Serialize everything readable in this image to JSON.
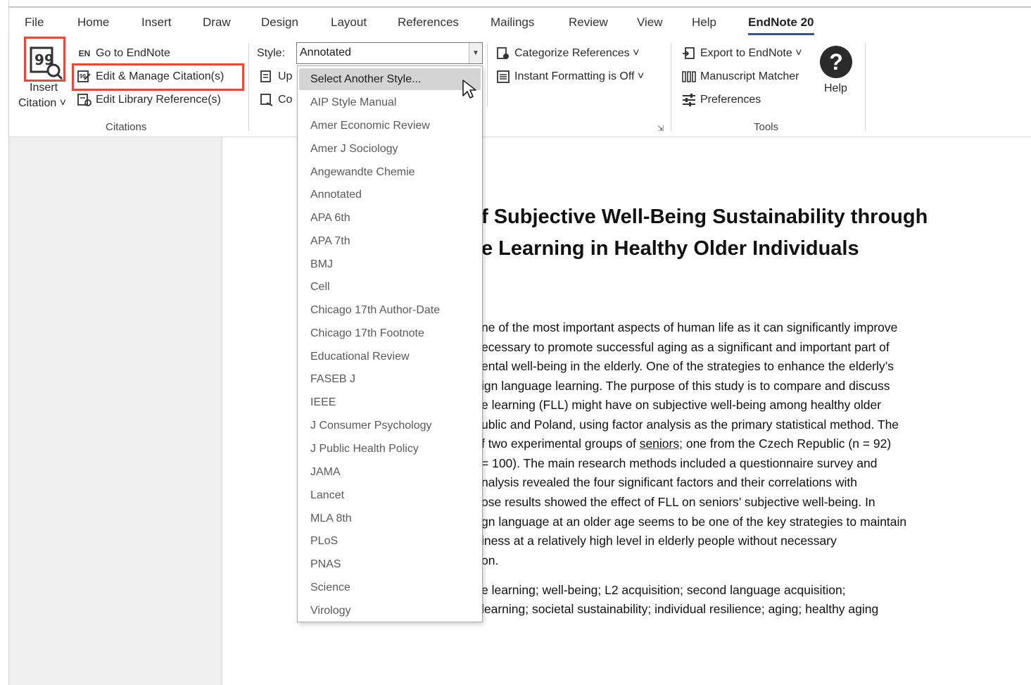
{
  "tabs": [
    "File",
    "Home",
    "Insert",
    "Draw",
    "Design",
    "Layout",
    "References",
    "Mailings",
    "Review",
    "View",
    "Help",
    "EndNote 20"
  ],
  "citations": {
    "insert_label_1": "Insert",
    "insert_label_2": "Citation ˅",
    "go_to_endnote": "Go to EndNote",
    "edit_manage": "Edit & Manage Citation(s)",
    "edit_library": "Edit Library Reference(s)",
    "group_label": "Citations"
  },
  "style": {
    "label": "Style:",
    "value": "Annotated",
    "update_partial": "Up",
    "convert_partial": "Co"
  },
  "bibliography": {
    "categorize": "Categorize References ˅",
    "instant_formatting": "Instant Formatting is Off ˅"
  },
  "tools": {
    "export": "Export to EndNote ˅",
    "manuscript": "Manuscript Matcher",
    "preferences": "Preferences",
    "help": "Help",
    "group_label": "Tools"
  },
  "style_options": [
    "Select Another Style...",
    "AIP Style Manual",
    "Amer Economic Review",
    "Amer J Sociology",
    "Angewandte Chemie",
    "Annotated",
    "APA 6th",
    "APA 7th",
    "BMJ",
    "Cell",
    "Chicago 17th Author-Date",
    "Chicago 17th Footnote",
    "Educational Review",
    "FASEB J",
    "IEEE",
    "J Consumer Psychology",
    "J Public Health Policy",
    "JAMA",
    "Lancet",
    "MLA 8th",
    "PLoS",
    "PNAS",
    "Science",
    "Virology"
  ],
  "document": {
    "title_line_1": "f Subjective Well-Being Sustainability through",
    "title_line_2": "e Learning in Healthy Older Individuals",
    "abstract": [
      "ne of the most important aspects of human life as it can significantly improve",
      "ecessary to promote successful aging as a significant and important part of",
      "ental well-being in the elderly. One of the strategies to enhance the elderly’s",
      "ign language learning. The purpose of this study is to compare and discuss",
      "e learning (FLL) might have on subjective well-being among healthy older",
      "ublic and Poland, using factor analysis as the primary statistical method. The",
      "= 100). The main research methods included a questionnaire survey and",
      "nalysis revealed the four significant factors and their correlations with",
      "ose results showed the effect of FLL on seniors’ subjective well-being. In",
      "gn language at an older age seems to be one of the key strategies to maintain",
      "iness at a relatively high level in elderly people without necessary",
      "on."
    ],
    "line7_pre": "f two experimental groups of ",
    "line7_link": "seniors;",
    "line7_post": " one from the Czech Republic (n = 92)",
    "keywords": [
      "e learning; well-being; L2 acquisition; second language acquisition;",
      "learning; societal sustainability; individual resilience; aging; healthy aging"
    ]
  }
}
